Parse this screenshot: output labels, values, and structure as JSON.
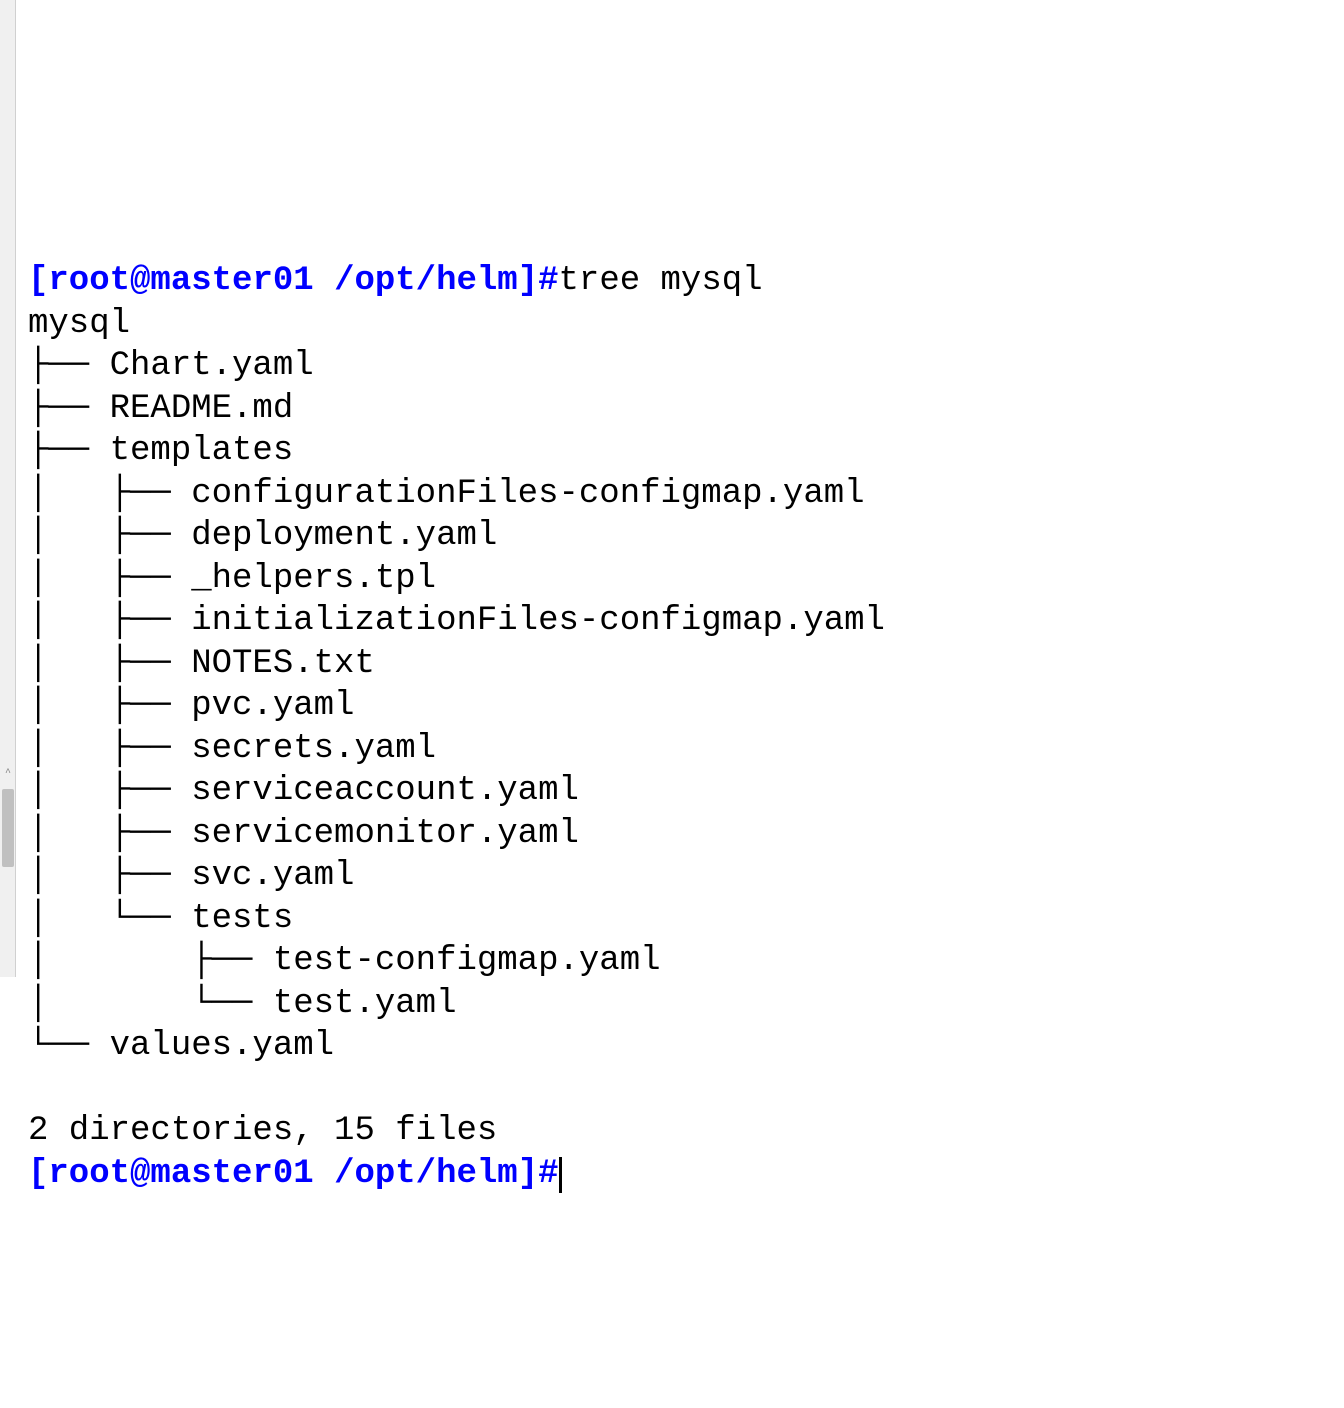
{
  "prompt1": {
    "open": "[",
    "user_host": "root@master01",
    "space": " ",
    "path": "/opt/helm",
    "close": "]",
    "hash": "#"
  },
  "command1": "tree mysql",
  "tree": {
    "root": "mysql",
    "line0": "├── Chart.yaml",
    "line1": "├── README.md",
    "line2": "├── templates",
    "line3": "│   ├── configurationFiles-configmap.yaml",
    "line4": "│   ├── deployment.yaml",
    "line5": "│   ├── _helpers.tpl",
    "line6": "│   ├── initializationFiles-configmap.yaml",
    "line7": "│   ├── NOTES.txt",
    "line8": "│   ├── pvc.yaml",
    "line9": "│   ├── secrets.yaml",
    "line10": "│   ├── serviceaccount.yaml",
    "line11": "│   ├── servicemonitor.yaml",
    "line12": "│   ├── svc.yaml",
    "line13": "│   └── tests",
    "line14": "│       ├── test-configmap.yaml",
    "line15": "│       └── test.yaml",
    "line16": "└── values.yaml"
  },
  "summary": "2 directories, 15 files",
  "prompt2": {
    "open": "[",
    "user_host": "root@master01",
    "space": " ",
    "path": "/opt/helm",
    "close": "]",
    "hash": "#"
  }
}
